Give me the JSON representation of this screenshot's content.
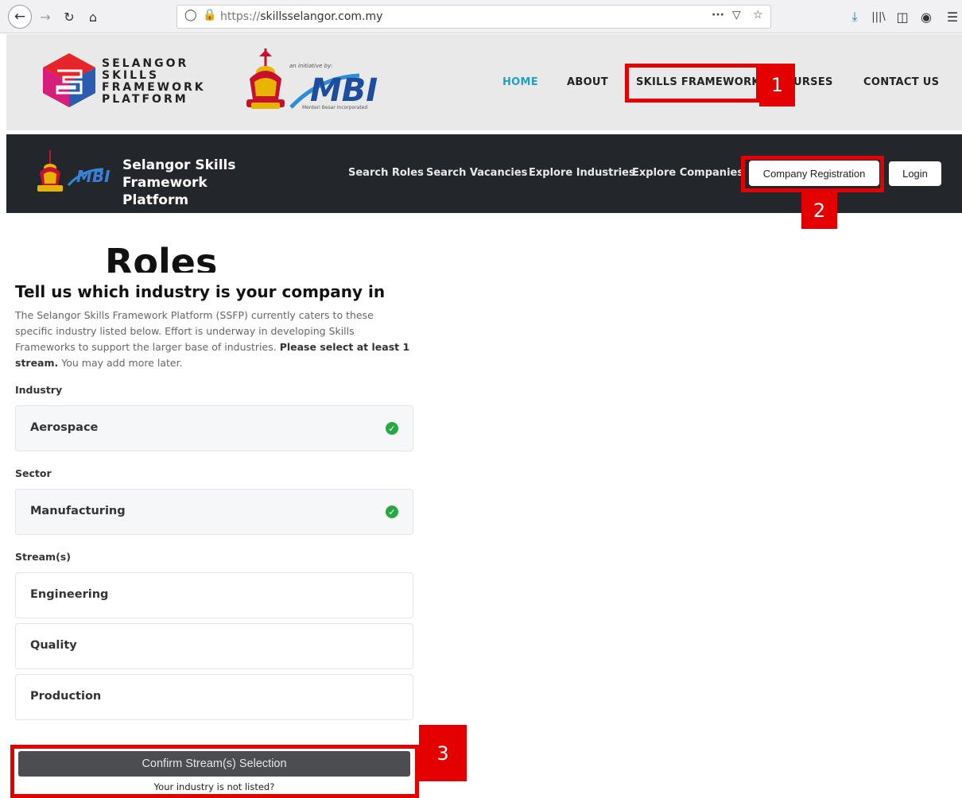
{
  "browser": {
    "url_prefix": "https://",
    "url_domain": "skillsselangor.com.my",
    "icons": [
      "back-icon",
      "forward-icon",
      "reload-icon",
      "home-icon",
      "shield-icon",
      "lock-icon",
      "more-icon",
      "pocket-icon",
      "star-icon",
      "download-icon",
      "library-icon",
      "sidebar-icon",
      "account-icon",
      "menu-icon"
    ]
  },
  "header": {
    "logo_lines": [
      "SELANGOR",
      "SKILLS",
      "FRAMEWORK",
      "PLATFORM"
    ],
    "initiative_text": "an initiative by:",
    "mbi_text": "MBI",
    "mbi_sub": "Menteri Besar Incorporated",
    "nav": {
      "home": "HOME",
      "about": "ABOUT",
      "skills": "SKILLS FRAMEWORK",
      "courses": "URSES",
      "contact": "CONTACT US"
    }
  },
  "subnav": {
    "brand_line1": "Selangor Skills Framework",
    "brand_line2": "Platform",
    "mbi_text": "MBI",
    "search_roles": "Search Roles",
    "search_vacancies": "Search Vacancies",
    "explore_industries": "Explore Industries",
    "explore_companies": "Explore Companies",
    "company_registration": "Company Registration",
    "login": "Login"
  },
  "page": {
    "heading": "Roles"
  },
  "panel": {
    "title": "Tell us which industry is your company in",
    "desc_part1": "The Selangor Skills Framework Platform (SSFP) currently caters to these specific industry listed below. Effort is underway in developing Skills Frameworks to support the larger base of industries.",
    "desc_bold": "Please select at least 1 stream.",
    "desc_part2": "You may add more later.",
    "industry_label": "Industry",
    "industry_value": "Aerospace",
    "sector_label": "Sector",
    "sector_value": "Manufacturing",
    "streams_label": "Stream(s)",
    "streams": [
      "Engineering",
      "Quality",
      "Production"
    ],
    "confirm_button": "Confirm Stream(s) Selection",
    "not_listed": "Your industry is not listed?"
  },
  "annotations": {
    "labels": [
      "1",
      "2",
      "3"
    ],
    "color": "#e50000"
  }
}
